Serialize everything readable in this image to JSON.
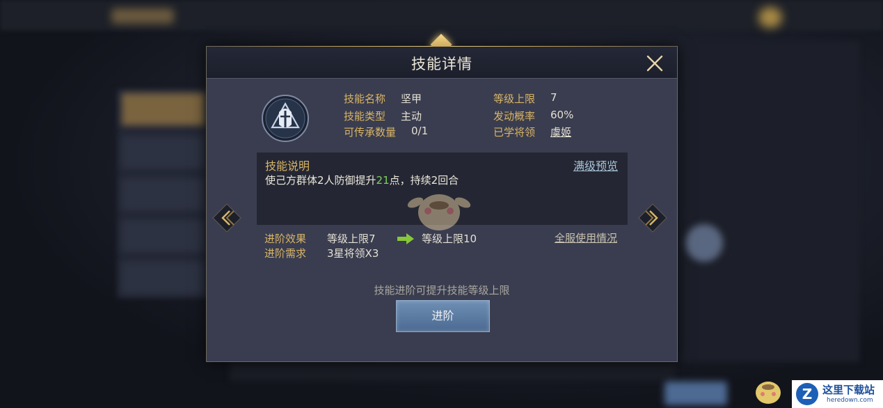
{
  "dialog": {
    "title": "技能详情",
    "close_icon": "close-icon"
  },
  "skill": {
    "icon": "knight-helmet-icon",
    "fields": [
      {
        "label": "技能名称",
        "value": "坚甲"
      },
      {
        "label": "技能类型",
        "value": "主动"
      },
      {
        "label": "可传承数量",
        "value": "0/1"
      },
      {
        "label": "等级上限",
        "value": "7"
      },
      {
        "label": "发动概率",
        "value": "60%"
      },
      {
        "label": "已学将领",
        "value": "虞姬"
      }
    ]
  },
  "description": {
    "title": "技能说明",
    "preview_link": "满级预览",
    "text_before": "使己方群体2人防御提升",
    "highlight": "21",
    "text_after": "点，持续2回合",
    "highlight_color": "#7ed35a"
  },
  "advance": {
    "effect_label": "进阶效果",
    "effect_from": "等级上限7",
    "effect_to": "等级上限10",
    "requirement_label": "进阶需求",
    "requirement_value": "3星将领X3",
    "global_usage_link": "全服使用情况",
    "hint": "技能进阶可提升技能等级上限",
    "button_label": "进阶"
  },
  "watermark": {
    "site_cn": "这里下载站",
    "site_en": "heredown.com",
    "logo_letter": "Z"
  },
  "colors": {
    "label_gold": "#d9b566",
    "dialog_bg": "#3a3d4f",
    "button_blue": "#5c7ba3"
  }
}
